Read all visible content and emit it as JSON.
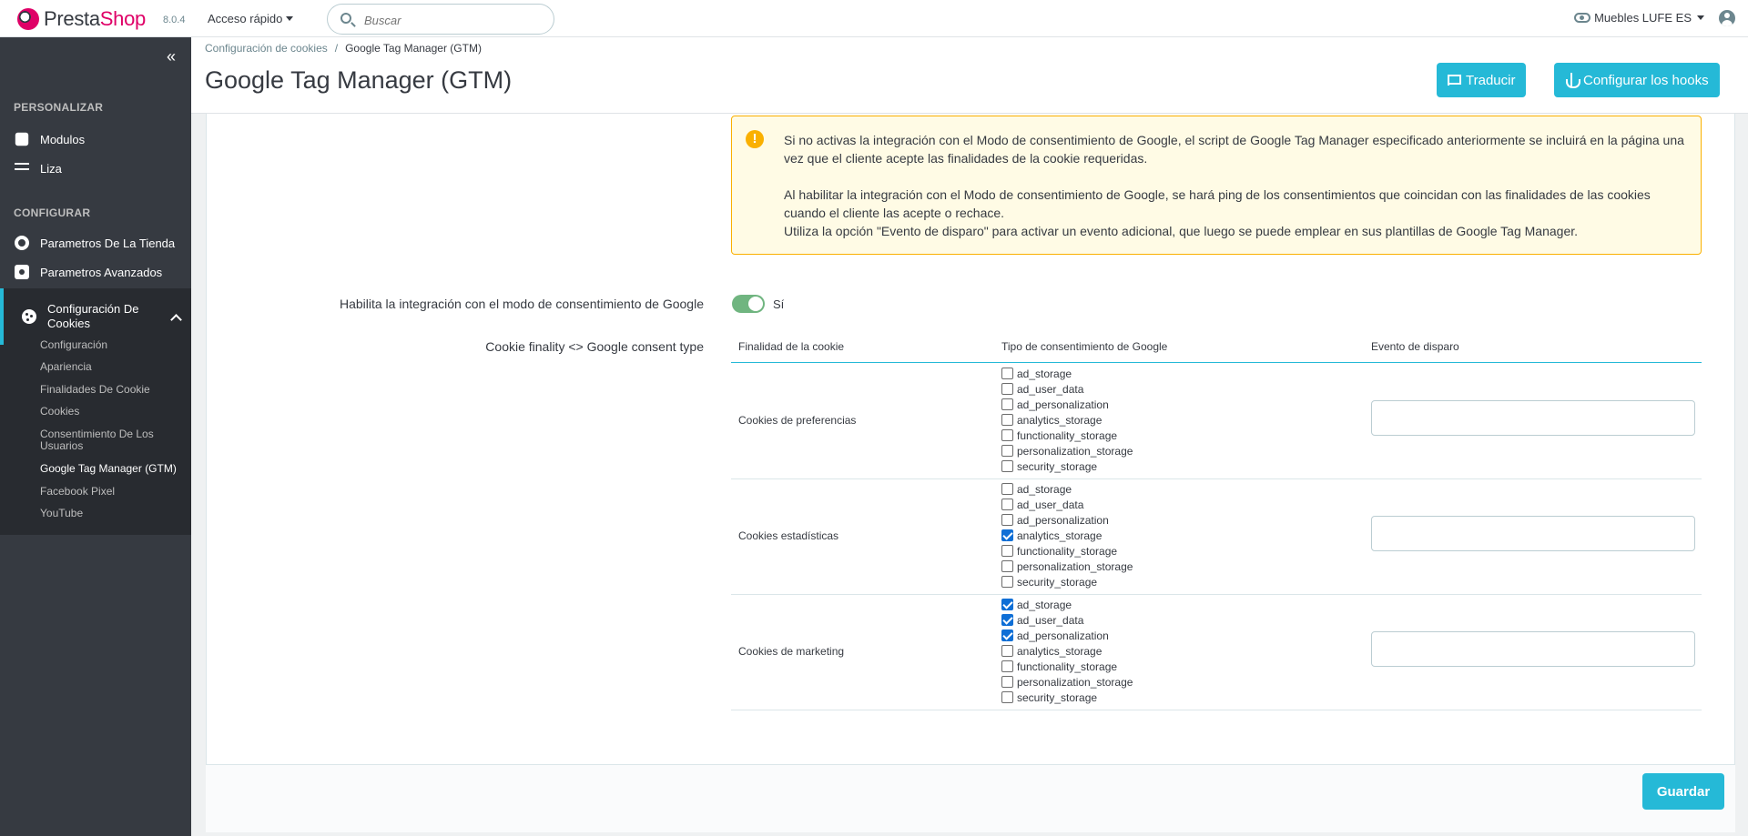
{
  "header": {
    "brand_prefix": "Presta",
    "brand_suffix": "Shop",
    "version": "8.0.4",
    "quick_access_label": "Acceso rápido",
    "search_placeholder": "Buscar",
    "shop_name": "Muebles LUFE ES",
    "icons": {
      "logo": "prestashop-logo",
      "search": "search-icon",
      "view_shop": "eye-icon",
      "account": "user-icon"
    }
  },
  "sidebar": {
    "collapse_glyph": "«",
    "sections": [
      {
        "title": "PERSONALIZAR",
        "items": [
          {
            "label": "Modulos",
            "icon": "puzzle-icon"
          },
          {
            "label": "Liza",
            "icon": "list-icon"
          }
        ]
      },
      {
        "title": "CONFIGURAR",
        "items": [
          {
            "label": "Parametros De La Tienda",
            "icon": "gear-icon"
          },
          {
            "label": "Parametros Avanzados",
            "icon": "advanced-gear-icon"
          },
          {
            "label": "Configuración De Cookies",
            "icon": "cookie-icon",
            "active": true
          }
        ]
      }
    ],
    "submenu": [
      {
        "label": "Configuración"
      },
      {
        "label": "Apariencia"
      },
      {
        "label": "Finalidades De Cookie"
      },
      {
        "label": "Cookies"
      },
      {
        "label": "Consentimiento De Los Usuarios"
      },
      {
        "label": "Google Tag Manager (GTM)",
        "current": true
      },
      {
        "label": "Facebook Pixel"
      },
      {
        "label": "YouTube"
      }
    ]
  },
  "page": {
    "breadcrumb": [
      "Configuración de cookies",
      "Google Tag Manager (GTM)"
    ],
    "breadcrumb_separator": "/",
    "title": "Google Tag Manager (GTM)",
    "translate_button": "Traducir",
    "hooks_button": "Configurar los hooks"
  },
  "alert": {
    "icon_glyph": "!",
    "paragraph_1": "Si no activas la integración con el Modo de consentimiento de Google, el script de Google Tag Manager especificado anteriormente se incluirá en la página una vez que el cliente acepte las finalidades de la cookie requeridas.",
    "paragraph_2": "Al habilitar la integración con el Modo de consentimiento de Google, se hará ping de los consentimientos que coincidan con las finalidades de las cookies cuando el cliente las acepte o rechace.",
    "paragraph_3": "Utiliza la opción \"Evento de disparo\" para activar un evento adicional, que luego se puede emplear en sus plantillas de Google Tag Manager."
  },
  "form": {
    "consent_mode_label": "Habilita la integración con el modo de consentimiento de Google",
    "consent_mode_value": "Sí",
    "consent_mode_enabled": true,
    "mapping_label": "Cookie finality <> Google consent type",
    "table": {
      "headers": [
        "Finalidad de la cookie",
        "Tipo de consentimiento de Google",
        "Evento de disparo"
      ],
      "rows": [
        {
          "finality": "Cookies de preferencias",
          "event": "",
          "consents": [
            {
              "name": "ad_storage",
              "checked": false
            },
            {
              "name": "ad_user_data",
              "checked": false
            },
            {
              "name": "ad_personalization",
              "checked": false
            },
            {
              "name": "analytics_storage",
              "checked": false
            },
            {
              "name": "functionality_storage",
              "checked": false
            },
            {
              "name": "personalization_storage",
              "checked": false
            },
            {
              "name": "security_storage",
              "checked": false
            }
          ]
        },
        {
          "finality": "Cookies estadísticas",
          "event": "",
          "consents": [
            {
              "name": "ad_storage",
              "checked": false
            },
            {
              "name": "ad_user_data",
              "checked": false
            },
            {
              "name": "ad_personalization",
              "checked": false
            },
            {
              "name": "analytics_storage",
              "checked": true
            },
            {
              "name": "functionality_storage",
              "checked": false
            },
            {
              "name": "personalization_storage",
              "checked": false
            },
            {
              "name": "security_storage",
              "checked": false
            }
          ]
        },
        {
          "finality": "Cookies de marketing",
          "event": "",
          "consents": [
            {
              "name": "ad_storage",
              "checked": true
            },
            {
              "name": "ad_user_data",
              "checked": true
            },
            {
              "name": "ad_personalization",
              "checked": true
            },
            {
              "name": "analytics_storage",
              "checked": false
            },
            {
              "name": "functionality_storage",
              "checked": false
            },
            {
              "name": "personalization_storage",
              "checked": false
            },
            {
              "name": "security_storage",
              "checked": false
            }
          ]
        }
      ]
    },
    "save_button": "Guardar"
  },
  "colors": {
    "primary": "#25b9d7",
    "sidebar_bg": "#363a41",
    "brand_pink": "#df0067",
    "alert_bg": "#fffbe5",
    "alert_border": "#fab000",
    "switch_on": "#70b580"
  }
}
